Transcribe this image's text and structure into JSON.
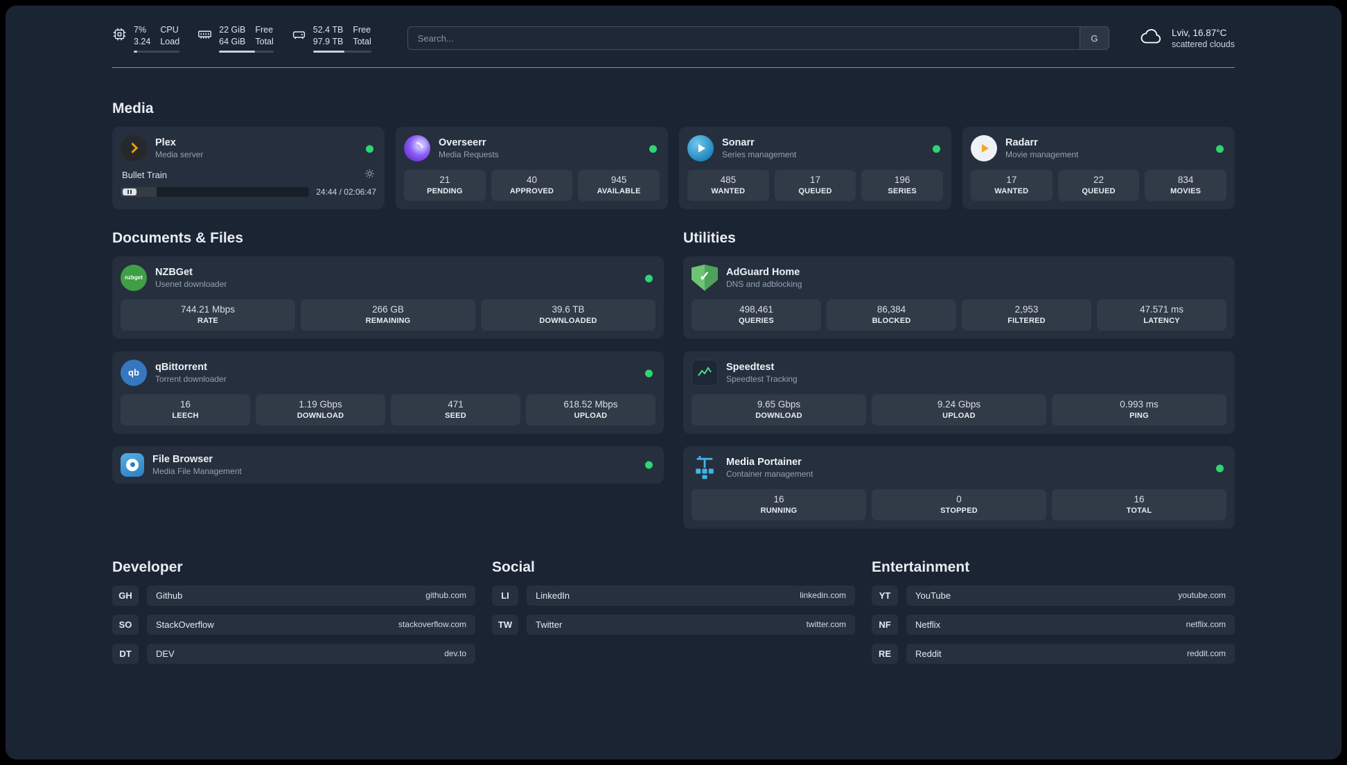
{
  "theme": {
    "bg_outer": "#000000",
    "bg_panel": "#1b2433",
    "status_green": "#2ed573",
    "plex_orange": "#e5a00d"
  },
  "topbar": {
    "cpu": {
      "value_top": "7%",
      "value_bottom": "3.24",
      "label_top": "CPU",
      "label_bottom": "Load"
    },
    "memory": {
      "value_top": "22 GiB",
      "value_bottom": "64 GiB",
      "label_top": "Free",
      "label_bottom": "Total"
    },
    "disk": {
      "value_top": "52.4 TB",
      "value_bottom": "97.9 TB",
      "label_top": "Free",
      "label_bottom": "Total"
    },
    "search": {
      "placeholder": "Search...",
      "button_label": "G"
    },
    "weather": {
      "line1": "Lviv, 16.87°C",
      "line2": "scattered clouds"
    }
  },
  "sections": {
    "media": {
      "title": "Media",
      "plex": {
        "name": "Plex",
        "desc": "Media server",
        "now_playing": "Bullet Train",
        "time": "24:44 / 02:06:47"
      },
      "overseerr": {
        "name": "Overseerr",
        "desc": "Media Requests",
        "stats": [
          {
            "value": "21",
            "label": "PENDING"
          },
          {
            "value": "40",
            "label": "APPROVED"
          },
          {
            "value": "945",
            "label": "AVAILABLE"
          }
        ]
      },
      "sonarr": {
        "name": "Sonarr",
        "desc": "Series management",
        "stats": [
          {
            "value": "485",
            "label": "WANTED"
          },
          {
            "value": "17",
            "label": "QUEUED"
          },
          {
            "value": "196",
            "label": "SERIES"
          }
        ]
      },
      "radarr": {
        "name": "Radarr",
        "desc": "Movie management",
        "stats": [
          {
            "value": "17",
            "label": "WANTED"
          },
          {
            "value": "22",
            "label": "QUEUED"
          },
          {
            "value": "834",
            "label": "MOVIES"
          }
        ]
      }
    },
    "documents": {
      "title": "Documents & Files",
      "nzbget": {
        "name": "NZBGet",
        "desc": "Usenet downloader",
        "stats": [
          {
            "value": "744.21 Mbps",
            "label": "RATE"
          },
          {
            "value": "266 GB",
            "label": "REMAINING"
          },
          {
            "value": "39.6 TB",
            "label": "DOWNLOADED"
          }
        ]
      },
      "qbittorrent": {
        "name": "qBittorrent",
        "desc": "Torrent downloader",
        "stats": [
          {
            "value": "16",
            "label": "LEECH"
          },
          {
            "value": "1.19 Gbps",
            "label": "DOWNLOAD"
          },
          {
            "value": "471",
            "label": "SEED"
          },
          {
            "value": "618.52 Mbps",
            "label": "UPLOAD"
          }
        ]
      },
      "filebrowser": {
        "name": "File Browser",
        "desc": "Media File Management"
      }
    },
    "utilities": {
      "title": "Utilities",
      "adguard": {
        "name": "AdGuard Home",
        "desc": "DNS and adblocking",
        "stats": [
          {
            "value": "498,461",
            "label": "QUERIES"
          },
          {
            "value": "86,384",
            "label": "BLOCKED"
          },
          {
            "value": "2,953",
            "label": "FILTERED"
          },
          {
            "value": "47.571 ms",
            "label": "LATENCY"
          }
        ]
      },
      "speedtest": {
        "name": "Speedtest",
        "desc": "Speedtest Tracking",
        "stats": [
          {
            "value": "9.65 Gbps",
            "label": "DOWNLOAD"
          },
          {
            "value": "9.24 Gbps",
            "label": "UPLOAD"
          },
          {
            "value": "0.993 ms",
            "label": "PING"
          }
        ]
      },
      "portainer": {
        "name": "Media Portainer",
        "desc": "Container management",
        "stats": [
          {
            "value": "16",
            "label": "RUNNING"
          },
          {
            "value": "0",
            "label": "STOPPED"
          },
          {
            "value": "16",
            "label": "TOTAL"
          }
        ]
      }
    },
    "bookmarks": {
      "developer": {
        "title": "Developer",
        "items": [
          {
            "abbr": "GH",
            "name": "Github",
            "url": "github.com"
          },
          {
            "abbr": "SO",
            "name": "StackOverflow",
            "url": "stackoverflow.com"
          },
          {
            "abbr": "DT",
            "name": "DEV",
            "url": "dev.to"
          }
        ]
      },
      "social": {
        "title": "Social",
        "items": [
          {
            "abbr": "LI",
            "name": "LinkedIn",
            "url": "linkedin.com"
          },
          {
            "abbr": "TW",
            "name": "Twitter",
            "url": "twitter.com"
          }
        ]
      },
      "entertainment": {
        "title": "Entertainment",
        "items": [
          {
            "abbr": "YT",
            "name": "YouTube",
            "url": "youtube.com"
          },
          {
            "abbr": "NF",
            "name": "Netflix",
            "url": "netflix.com"
          },
          {
            "abbr": "RE",
            "name": "Reddit",
            "url": "reddit.com"
          }
        ]
      }
    }
  },
  "icons": {
    "nzbget_text": "nzbget",
    "qbittorrent_text": "qb",
    "adguard_check": "✓"
  }
}
